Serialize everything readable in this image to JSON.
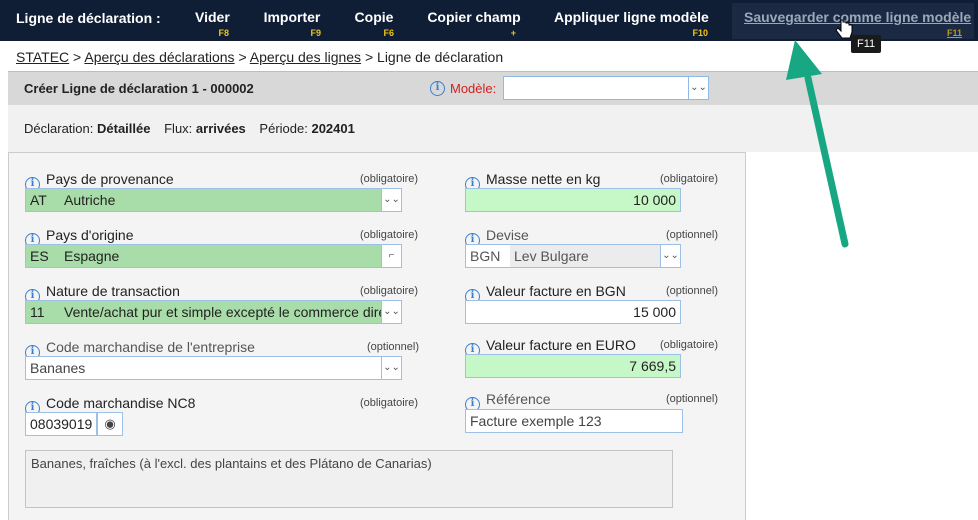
{
  "toolbar": {
    "title": "Ligne de déclaration :",
    "buttons": [
      {
        "label": "Vider",
        "key": "F8"
      },
      {
        "label": "Importer",
        "key": "F9"
      },
      {
        "label": "Copie",
        "key": "F6"
      },
      {
        "label": "Copier champ",
        "key": "+"
      },
      {
        "label": "Appliquer ligne modèle",
        "key": "F10"
      }
    ],
    "save": {
      "label": "Sauvegarder comme ligne modèle",
      "key": "F11"
    },
    "tooltip": "F11"
  },
  "breadcrumb": {
    "items": [
      "STATEC",
      "Aperçu des déclarations",
      "Aperçu des lignes"
    ],
    "current": "Ligne de déclaration",
    "separator": ">"
  },
  "header": {
    "title": "Créer Ligne de déclaration 1 - 000002",
    "model_label": "Modèle:",
    "model_value": ""
  },
  "summary": {
    "declaration_label": "Déclaration:",
    "declaration_value": "Détaillée",
    "flux_label": "Flux:",
    "flux_value": "arrivées",
    "periode_label": "Période:",
    "periode_value": "202401"
  },
  "form": {
    "pays_provenance": {
      "label": "Pays de provenance",
      "req": "(obligatoire)",
      "code": "AT",
      "name": "Autriche"
    },
    "pays_origine": {
      "label": "Pays d'origine",
      "req": "(obligatoire)",
      "code": "ES",
      "name": "Espagne"
    },
    "nature_transaction": {
      "label": "Nature de transaction",
      "req": "(obligatoire)",
      "code": "11",
      "name": "Vente/achat pur et simple excepté le commerce direct"
    },
    "code_entreprise": {
      "label": "Code marchandise de l'entreprise",
      "req": "(optionnel)",
      "value": "Bananes"
    },
    "code_nc8": {
      "label": "Code marchandise NC8",
      "req": "(obligatoire)",
      "value": "08039019"
    },
    "masse_nette": {
      "label": "Masse nette en kg",
      "req": "(obligatoire)",
      "value": "10 000"
    },
    "devise": {
      "label": "Devise",
      "req": "(optionnel)",
      "code": "BGN",
      "name": "Lev Bulgare"
    },
    "valeur_bgn": {
      "label": "Valeur facture en BGN",
      "req": "(optionnel)",
      "value": "15 000"
    },
    "valeur_euro": {
      "label": "Valeur facture en EURO",
      "req": "(obligatoire)",
      "value": "7 669,5"
    },
    "reference": {
      "label": "Référence",
      "req": "(optionnel)",
      "value": "Facture exemple 123"
    },
    "description": "Bananes, fraîches (à l'excl. des plantains et des Plátano de Canarias)"
  },
  "colors": {
    "accent_green": "#a8dca8",
    "toolbar_bg": "#0f1e35",
    "arrow": "#17a883"
  },
  "icons": {
    "info": "info-icon",
    "dropdown": "chevron-down-icon",
    "eye": "eye-icon",
    "cursor": "hand-cursor-icon"
  }
}
